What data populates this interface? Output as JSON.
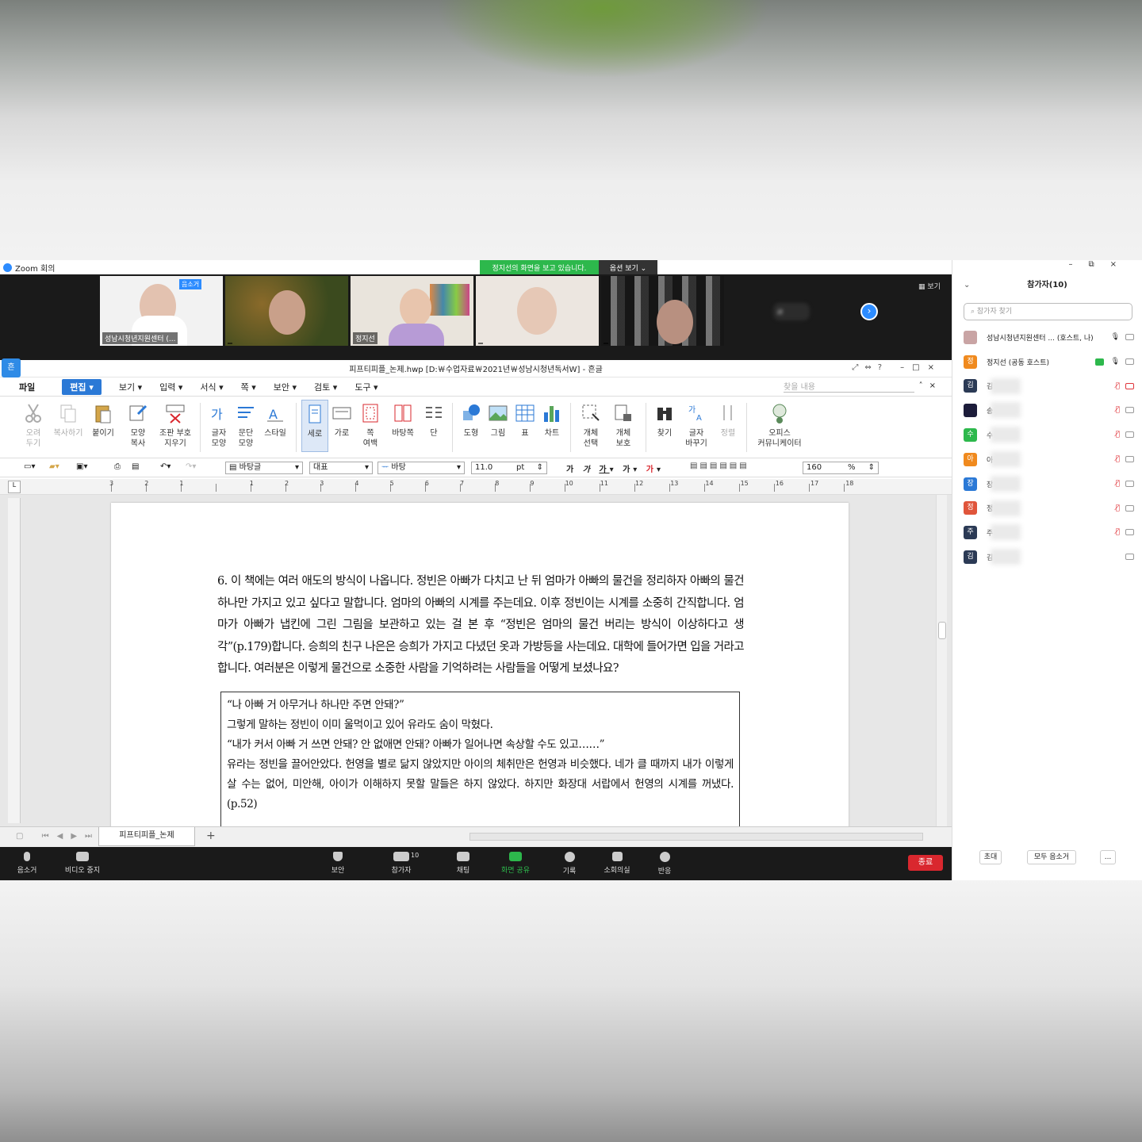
{
  "zoom": {
    "window_title": "Zoom 회의",
    "share_banner": "정지선의 화면을 보고 있습니다.",
    "view_options": "옵션 보기 ⌄",
    "view_button": "보기",
    "gallery": [
      {
        "name": "성남시청년지원센터 (..."
      },
      {
        "name": ""
      },
      {
        "name": "정지선"
      },
      {
        "name": ""
      },
      {
        "name": ""
      },
      {
        "name": "ㄹ"
      }
    ],
    "mute_badge": "음소거",
    "toolbar": {
      "mute": "음소거",
      "video": "비디오 중지",
      "security": "보안",
      "participants": "참가자",
      "participants_count": "10",
      "chat": "채팅",
      "share": "화면 공유",
      "record": "기록",
      "breakout": "소회의실",
      "reactions": "반응",
      "end": "종료"
    }
  },
  "hwp": {
    "title": "피프티피플_논제.hwp [D:￦수업자료￦2021년￦성남시청년독서W] - 흔글",
    "menu": [
      {
        "label": "파일"
      },
      {
        "label": "편집 ▾"
      },
      {
        "label": "보기 ▾"
      },
      {
        "label": "입력 ▾"
      },
      {
        "label": "서식 ▾"
      },
      {
        "label": "쪽 ▾"
      },
      {
        "label": "보안 ▾"
      },
      {
        "label": "검토 ▾"
      },
      {
        "label": "도구 ▾"
      }
    ],
    "search_placeholder": "찾을 내용",
    "ribbon": [
      {
        "label": "오려\n두기",
        "icon": "scissors-icon",
        "disabled": true
      },
      {
        "label": "복사하기",
        "icon": "copy-icon",
        "disabled": true
      },
      {
        "label": "붙이기",
        "icon": "paste-icon"
      },
      {
        "label": "모양\n복사",
        "icon": "format-copy-icon"
      },
      {
        "label": "조판 부호\n지우기",
        "icon": "clear-marks-icon"
      },
      {
        "label": "글자\n모양",
        "icon": "char-shape-icon"
      },
      {
        "label": "문단\n모양",
        "icon": "para-shape-icon"
      },
      {
        "label": "스타일",
        "icon": "style-icon"
      },
      {
        "label": "세로",
        "icon": "portrait-icon",
        "active": true
      },
      {
        "label": "가로",
        "icon": "landscape-icon"
      },
      {
        "label": "쪽\n여백",
        "icon": "margin-icon"
      },
      {
        "label": "바탕쪽",
        "icon": "master-page-icon"
      },
      {
        "label": "단",
        "icon": "columns-icon"
      },
      {
        "label": "도형",
        "icon": "shape-icon"
      },
      {
        "label": "그림",
        "icon": "picture-icon"
      },
      {
        "label": "표",
        "icon": "table-icon"
      },
      {
        "label": "차트",
        "icon": "chart-icon"
      },
      {
        "label": "개체\n선택",
        "icon": "select-object-icon"
      },
      {
        "label": "개체\n보호",
        "icon": "protect-object-icon"
      },
      {
        "label": "찾기",
        "icon": "binoculars-icon"
      },
      {
        "label": "글자\n바꾸기",
        "icon": "replace-icon"
      },
      {
        "label": "정렬",
        "icon": "sort-icon",
        "disabled": true
      },
      {
        "label": "오피스\n커뮤니케이터",
        "icon": "communicator-icon"
      }
    ],
    "format": {
      "style": "바탕글",
      "lang": "대표",
      "font": "바탕",
      "size": "11.0",
      "unit": "pt",
      "zoom": "160",
      "zoom_unit": "%"
    },
    "ruler_numbers": [
      "3",
      "2",
      "1",
      "",
      "1",
      "2",
      "3",
      "4",
      "5",
      "6",
      "7",
      "8",
      "9",
      "10",
      "11",
      "12",
      "13",
      "14",
      "15",
      "16",
      "17",
      "18"
    ],
    "paragraph": "6. 이 책에는 여러 애도의 방식이 나옵니다. 정빈은 아빠가 다치고 난 뒤 엄마가 아빠의 물건을 정리하자 아빠의 물건 하나만 가지고 있고 싶다고 말합니다. 엄마의 아빠의 시계를 주는데요. 이후 정빈이는 시계를 소중히 간직합니다. 엄마가 아빠가 냅킨에 그린 그림을 보관하고 있는 걸 본 후 “정빈은 엄마의 물건 버리는 방식이 이상하다고 생각”(p.179)합니다. 승희의 친구 나은은 승희가 가지고 다녔던 옷과 가방등을 사는데요. 대학에 들어가면 입을 거라고 합니다. 여러분은 이렇게 물건으로 소중한 사람을 기억하려는 사람들을 어떻게 보셨나요?",
    "quote": [
      "“나 아빠 거 아무거나 하나만 주면 안돼?”",
      "그렇게 말하는 정빈이 이미 울먹이고 있어 유라도 숨이 막혔다.",
      "“내가 커서 아빠 거 쓰면 안돼? 안 없애면 안돼? 아빠가 일어나면 속상할 수도 있고……”",
      "유라는 정빈을 끌어안았다. 헌영을 별로 닮지 않았지만 아이의 체취만은 헌영과 비슷했다. 네가 클 때까지 내가 이렇게 살 수는 없어, 미안해, 아이가 이해하지 못할 말들은 하지 않았다. 하지만 화장대 서랍에서 헌영의 시계를 꺼냈다. (p.52)"
    ],
    "tab_name": "피프티피플_논제"
  },
  "panel": {
    "title": "참가자(10)",
    "search_placeholder": "참가자 찾기",
    "participants": [
      {
        "initial": "",
        "name": "성남시청년지원센터 ... (호스트, 나)",
        "color": "#c9a4a4",
        "muted": false
      },
      {
        "initial": "정",
        "name": "정지선 (공동 호스트)",
        "color": "#f08a1e",
        "muted": false,
        "sharing": true
      },
      {
        "initial": "김",
        "name": "김",
        "color": "#2b3a55",
        "muted": true
      },
      {
        "initial": "",
        "name": "송",
        "color": "#1c1c3a",
        "muted": true
      },
      {
        "initial": "수",
        "name": "수",
        "color": "#2db84c",
        "muted": true
      },
      {
        "initial": "아",
        "name": "아",
        "color": "#f08a1e",
        "muted": true
      },
      {
        "initial": "장",
        "name": "장",
        "color": "#2b79d6",
        "muted": true
      },
      {
        "initial": "정",
        "name": "정",
        "color": "#e0553b",
        "muted": true
      },
      {
        "initial": "주",
        "name": "주",
        "color": "#2b3a55",
        "muted": true
      },
      {
        "initial": "김",
        "name": "김",
        "color": "#2b3a55",
        "muted": false
      }
    ],
    "invite": "초대",
    "mute_all": "모두 음소거",
    "more": "..."
  }
}
